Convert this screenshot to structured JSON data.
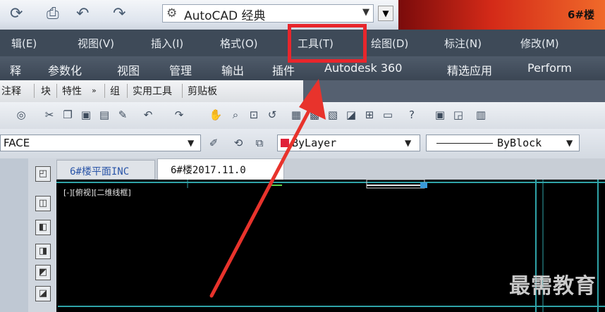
{
  "title_bar": {
    "app_title": "AutoCAD 经典",
    "file_fragment": "6#楼"
  },
  "menu_bar": {
    "items": [
      "辑(E)",
      "视图(V)",
      "插入(I)",
      "格式(O)",
      "工具(T)",
      "绘图(D)",
      "标注(N)",
      "修改(M)"
    ]
  },
  "ribbon_tabs": {
    "items": [
      "释",
      "参数化",
      "视图",
      "管理",
      "输出",
      "插件",
      "Autodesk 360",
      "精选应用",
      "Perform"
    ]
  },
  "panel_bar": {
    "items": [
      "注释",
      "块",
      "特性",
      "组",
      "实用工具",
      "剪贴板"
    ]
  },
  "properties": {
    "text_style": "FACE",
    "layer_value": "ByLayer",
    "linetype_value": "ByBlock",
    "layer_color": "#e0223a"
  },
  "document_tabs": {
    "tab1": "6#楼平面INC",
    "tab2": "6#楼2017.11.0"
  },
  "drawing": {
    "viewport_label": "[-][俯视][二维线框]"
  },
  "highlight": {
    "target": "工具(T)",
    "color": "#e8262c"
  },
  "watermark": {
    "text": "最需教育"
  }
}
